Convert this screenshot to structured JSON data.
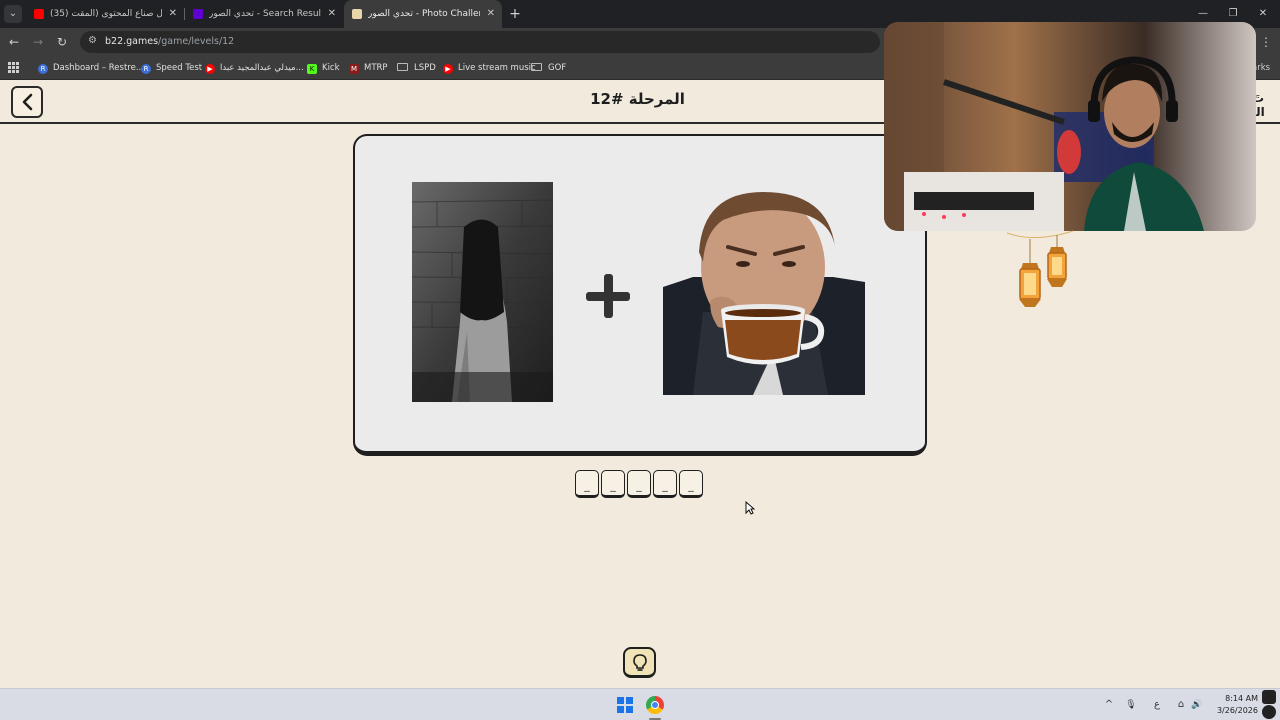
{
  "browser": {
    "tabs": [
      {
        "title": "(35) مشاكل صناع المحتوى (المقت",
        "favicon_color": "#ff0000",
        "active": false
      },
      {
        "title": "تحدي الصور - Search Results ◦◦",
        "favicon_color": "#6001d2",
        "active": false
      },
      {
        "title": "تحدي الصور - Photo Challenge",
        "favicon_color": "#e8d6a8",
        "active": true
      }
    ],
    "tab_close_glyph": "✕",
    "new_tab_glyph": "+",
    "tab_list_glyph": "⌄",
    "window_controls": {
      "minimize": "—",
      "restore": "❐",
      "close": "✕"
    },
    "nav": {
      "back": "←",
      "forward": "→",
      "reload": "↻",
      "more": "⋮"
    },
    "url": {
      "host": "b22.games",
      "path": "/game/levels/12"
    },
    "bookmarks": [
      {
        "label": "Dashboard – Restre...",
        "icon": "R",
        "icon_color": "#3b6fd8"
      },
      {
        "label": "Speed Test",
        "icon": "R",
        "icon_color": "#3b6fd8"
      },
      {
        "label": "ميدلي عبدالمجيد عبدا...",
        "icon": "▶",
        "icon_color": "#ff0000"
      },
      {
        "label": "Kick",
        "icon": "K",
        "icon_color": "#53fc18"
      },
      {
        "label": "MTRP",
        "icon": "M",
        "icon_color": "#8a1c1c"
      },
      {
        "label": "LSPD",
        "icon": "folder"
      },
      {
        "label": "Live stream music",
        "icon": "▶",
        "icon_color": "#ff0000"
      },
      {
        "label": "GOF",
        "icon": "folder"
      }
    ],
    "bookmarks_overflow": "arks"
  },
  "game": {
    "level_title": "المرحلة #12",
    "logo_fragment": "تَ الـ",
    "clue_images": [
      "ghost-woman-photo",
      "man-drinking-tea-photo"
    ],
    "operator": "plus-icon",
    "answer_slots": [
      "_",
      "_",
      "_",
      "_",
      "_"
    ],
    "hint_icon": "lightbulb-icon",
    "accent_color": "#f1e3b8",
    "background_color": "#f2ebdd"
  },
  "taskbar": {
    "tray": {
      "chevron": "^",
      "mic": "🎙",
      "ime": "ع",
      "network": "⌂",
      "volume": "🔊"
    },
    "time": "8:14 AM",
    "date": "3/26/2026"
  }
}
